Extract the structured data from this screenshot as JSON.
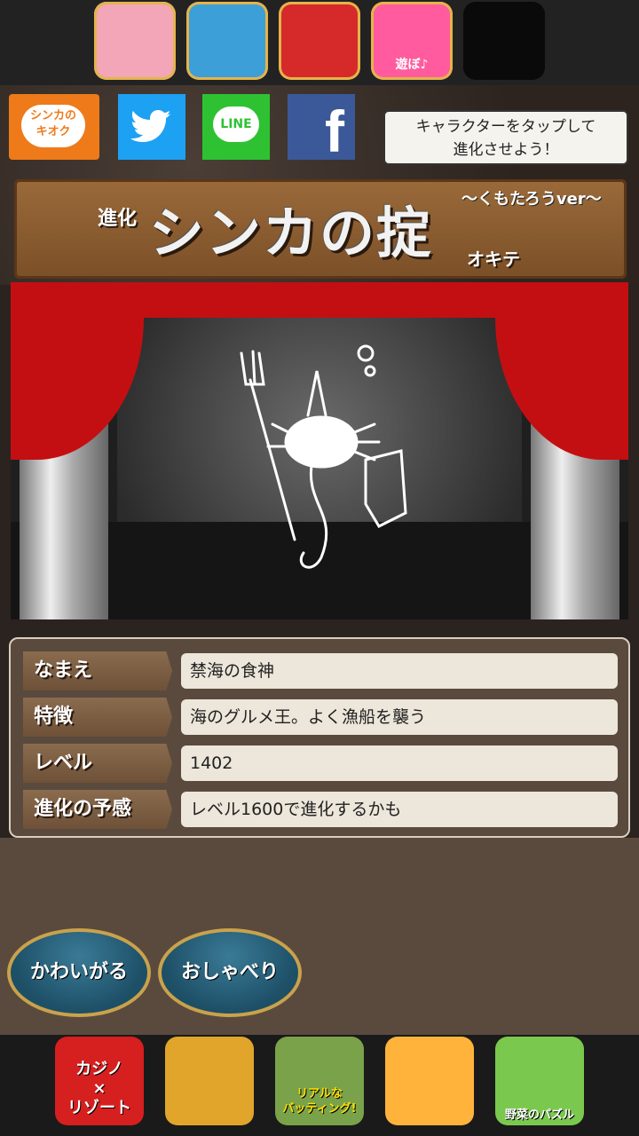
{
  "top_apps": [
    {
      "name": "app-princess",
      "color": "#f3a6b8",
      "label": ""
    },
    {
      "name": "app-panda-bubble",
      "color": "#3c9fd8",
      "label": ""
    },
    {
      "name": "app-red-dragon",
      "color": "#d62a2a",
      "label": ""
    },
    {
      "name": "app-asobo",
      "color": "#ff5b9e",
      "label": "遊ぼ♪"
    },
    {
      "name": "app-jelly",
      "color": "#0a0a0a",
      "label": ""
    }
  ],
  "share": {
    "memory_label": "シンカの\nキオク",
    "twitter_icon": "twitter-bird-icon",
    "line_label": "LINE",
    "facebook_label": "f"
  },
  "tip": {
    "text": "キャラクターをタップして\n進化させよう！"
  },
  "title": {
    "prefix": "進化",
    "main": "シンカの掟",
    "ver": "〜くもたろうver〜",
    "okite": "オキテ"
  },
  "info": {
    "rows": [
      {
        "label": "なまえ",
        "value": "禁海の食神"
      },
      {
        "label": "特徴",
        "value": "海のグルメ王。よく漁船を襲う"
      },
      {
        "label": "レベル",
        "value": "1402"
      },
      {
        "label": "進化の予感",
        "value": "レベル1600で進化するかも"
      }
    ]
  },
  "actions": {
    "pet_label": "かわいがる",
    "talk_label": "おしゃべり"
  },
  "bottom_apps": [
    {
      "name": "app-casino",
      "color": "#d61f1f",
      "label": "カジノ\n×\nリゾート"
    },
    {
      "name": "app-dragon",
      "color": "#e0a52a",
      "label": ""
    },
    {
      "name": "app-batting",
      "color": "#7aa24a",
      "label": "リアルな\nバッティング!"
    },
    {
      "name": "app-knight",
      "color": "#ffb33a",
      "label": ""
    },
    {
      "name": "app-veggie",
      "color": "#7ac94e",
      "label": "野菜のパズル"
    }
  ]
}
